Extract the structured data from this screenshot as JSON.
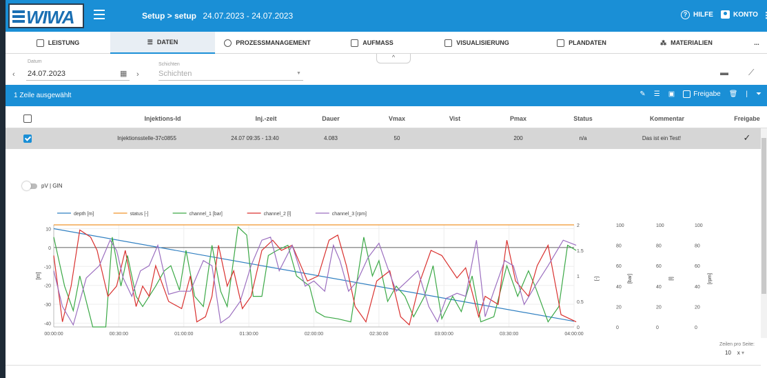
{
  "header": {
    "crumb": "Setup > setup",
    "dates": "24.07.2023 - 24.07.2023",
    "help": "HILFE",
    "account": "KONTO"
  },
  "tabs": [
    {
      "label": "LEISTUNG",
      "icon": "chart-area-icon"
    },
    {
      "label": "DATEN",
      "icon": "list-icon",
      "active": true
    },
    {
      "label": "PROZESSMANAGEMENT",
      "icon": "clock-icon"
    },
    {
      "label": "AUFMASS",
      "icon": "clipboard-icon"
    },
    {
      "label": "VISUALISIERUNG",
      "icon": "map-icon"
    },
    {
      "label": "PLANDATEN",
      "icon": "plus-box-icon"
    },
    {
      "label": "MATERIALIEN",
      "icon": "molecule-icon"
    },
    {
      "label": "..."
    }
  ],
  "filters": {
    "date_label": "Datum",
    "date_value": "24.07.2023",
    "shift_label": "Schichten",
    "shift_placeholder": "Schichten"
  },
  "toolbar": {
    "selection": "1 Zeile ausgewählt",
    "release": "Freigabe"
  },
  "table": {
    "columns": [
      "Injektions-Id",
      "Inj.-zeit",
      "Dauer",
      "Vmax",
      "Vist",
      "Pmax",
      "Status",
      "Kommentar",
      "Freigabe"
    ],
    "rows": [
      {
        "id": "Injektionsstelle-37c0855",
        "time": "24.07 09:35 - 13:40",
        "duration": "4.083",
        "vmax": "50",
        "vist": "",
        "pmax": "200",
        "status": "n/a",
        "comment": "Das ist ein Test!",
        "released": "✓"
      }
    ]
  },
  "detail": {
    "toggle_label": "pV | GIN"
  },
  "pager": {
    "label": "Zeilen pro Seite:",
    "value": "10",
    "clear": "x"
  },
  "colors": {
    "brand": "#1a8fd6",
    "selected_row": "#d6d6d6"
  },
  "chart_data": {
    "type": "line",
    "x_ticks": [
      "00:00:00",
      "00:30:00",
      "01:00:00",
      "01:30:00",
      "02:00:00",
      "02:30:00",
      "03:00:00",
      "03:30:00",
      "04:00:00"
    ],
    "axes": [
      {
        "label": "[m]",
        "ticks": [
          "10",
          "0",
          "-10",
          "-20",
          "-30",
          "-40"
        ],
        "range": [
          -42,
          12
        ]
      },
      {
        "label": "[-]",
        "ticks": [
          "2",
          "1.5",
          "1",
          "0.5",
          "0"
        ],
        "range": [
          0,
          2
        ]
      },
      {
        "label": "[bar]",
        "ticks": [
          "100",
          "80",
          "60",
          "40",
          "20",
          "0"
        ],
        "range": [
          0,
          100
        ]
      },
      {
        "label": "[l]",
        "ticks": [
          "100",
          "80",
          "60",
          "40",
          "20",
          "0"
        ],
        "range": [
          0,
          100
        ]
      },
      {
        "label": "[rpm]",
        "ticks": [
          "100",
          "80",
          "60",
          "40",
          "20",
          "0"
        ],
        "range": [
          0,
          100
        ]
      }
    ],
    "series": [
      {
        "name": "depth [m]",
        "color": "#2f7fc1",
        "axis": 0,
        "points": [
          [
            0,
            10
          ],
          [
            240,
            -39
          ]
        ]
      },
      {
        "name": "status [-]",
        "color": "#f0942a",
        "axis": 1,
        "points": [
          [
            0,
            2
          ],
          [
            240,
            2
          ]
        ]
      },
      {
        "name": "channel_1 [bar]",
        "color": "#3aa845",
        "axis": 2,
        "points": [
          [
            0,
            88
          ],
          [
            5,
            40
          ],
          [
            9,
            16
          ],
          [
            12,
            50
          ],
          [
            18,
            0
          ],
          [
            24,
            0
          ],
          [
            27,
            88
          ],
          [
            31,
            40
          ],
          [
            34,
            70
          ],
          [
            38,
            30
          ],
          [
            41,
            20
          ],
          [
            47,
            40
          ],
          [
            51,
            55
          ],
          [
            54,
            60
          ],
          [
            58,
            36
          ],
          [
            61,
            75
          ],
          [
            65,
            30
          ],
          [
            69,
            20
          ],
          [
            73,
            80
          ],
          [
            77,
            35
          ],
          [
            80,
            20
          ],
          [
            85,
            98
          ],
          [
            89,
            90
          ],
          [
            92,
            30
          ],
          [
            96,
            30
          ],
          [
            99,
            70
          ],
          [
            103,
            75
          ],
          [
            108,
            80
          ],
          [
            112,
            50
          ],
          [
            118,
            40
          ],
          [
            121,
            15
          ],
          [
            125,
            10
          ],
          [
            131,
            8
          ],
          [
            137,
            5
          ],
          [
            143,
            88
          ],
          [
            147,
            50
          ],
          [
            150,
            65
          ],
          [
            154,
            25
          ],
          [
            158,
            40
          ],
          [
            162,
            30
          ],
          [
            166,
            10
          ],
          [
            171,
            30
          ],
          [
            175,
            60
          ],
          [
            179,
            8
          ],
          [
            184,
            30
          ],
          [
            188,
            15
          ],
          [
            193,
            50
          ],
          [
            197,
            5
          ],
          [
            203,
            10
          ],
          [
            209,
            60
          ],
          [
            214,
            30
          ],
          [
            219,
            55
          ],
          [
            222,
            40
          ],
          [
            228,
            5
          ],
          [
            233,
            20
          ],
          [
            237,
            80
          ],
          [
            241,
            75
          ]
        ]
      },
      {
        "name": "channel_2 [l]",
        "color": "#d9302e",
        "axis": 3,
        "points": [
          [
            0,
            70
          ],
          [
            4,
            5
          ],
          [
            8,
            40
          ],
          [
            12,
            95
          ],
          [
            17,
            88
          ],
          [
            20,
            75
          ],
          [
            25,
            30
          ],
          [
            29,
            40
          ],
          [
            33,
            75
          ],
          [
            38,
            20
          ],
          [
            41,
            40
          ],
          [
            44,
            30
          ],
          [
            47,
            60
          ],
          [
            53,
            25
          ],
          [
            59,
            18
          ],
          [
            63,
            50
          ],
          [
            66,
            5
          ],
          [
            70,
            10
          ],
          [
            73,
            30
          ],
          [
            76,
            80
          ],
          [
            80,
            40
          ],
          [
            83,
            55
          ],
          [
            87,
            18
          ],
          [
            91,
            30
          ],
          [
            96,
            75
          ],
          [
            101,
            85
          ],
          [
            105,
            75
          ],
          [
            110,
            80
          ],
          [
            114,
            60
          ],
          [
            117,
            45
          ],
          [
            122,
            50
          ],
          [
            127,
            85
          ],
          [
            131,
            90
          ],
          [
            135,
            60
          ],
          [
            139,
            20
          ],
          [
            144,
            5
          ],
          [
            149,
            45
          ],
          [
            155,
            55
          ],
          [
            160,
            10
          ],
          [
            164,
            2
          ],
          [
            169,
            45
          ],
          [
            174,
            75
          ],
          [
            179,
            70
          ],
          [
            186,
            48
          ],
          [
            190,
            58
          ],
          [
            196,
            10
          ],
          [
            199,
            30
          ],
          [
            205,
            22
          ],
          [
            209,
            85
          ],
          [
            213,
            45
          ],
          [
            219,
            30
          ],
          [
            223,
            60
          ],
          [
            228,
            80
          ],
          [
            234,
            12
          ],
          [
            241,
            5
          ]
        ]
      },
      {
        "name": "channel_3 [rpm]",
        "color": "#9b6ebf",
        "axis": 4,
        "points": [
          [
            0,
            55
          ],
          [
            4,
            20
          ],
          [
            9,
            2
          ],
          [
            15,
            48
          ],
          [
            21,
            60
          ],
          [
            26,
            85
          ],
          [
            29,
            75
          ],
          [
            32,
            48
          ],
          [
            36,
            30
          ],
          [
            40,
            55
          ],
          [
            44,
            60
          ],
          [
            48,
            80
          ],
          [
            53,
            32
          ],
          [
            58,
            35
          ],
          [
            63,
            35
          ],
          [
            69,
            65
          ],
          [
            73,
            60
          ],
          [
            77,
            4
          ],
          [
            81,
            10
          ],
          [
            86,
            25
          ],
          [
            91,
            60
          ],
          [
            96,
            85
          ],
          [
            100,
            88
          ],
          [
            104,
            55
          ],
          [
            110,
            80
          ],
          [
            116,
            40
          ],
          [
            120,
            45
          ],
          [
            125,
            35
          ],
          [
            129,
            80
          ],
          [
            132,
            65
          ],
          [
            136,
            35
          ],
          [
            140,
            45
          ],
          [
            145,
            68
          ],
          [
            150,
            82
          ],
          [
            154,
            58
          ],
          [
            158,
            35
          ],
          [
            163,
            45
          ],
          [
            168,
            55
          ],
          [
            173,
            20
          ],
          [
            177,
            5
          ],
          [
            181,
            28
          ],
          [
            186,
            33
          ],
          [
            190,
            30
          ],
          [
            195,
            85
          ],
          [
            199,
            10
          ],
          [
            203,
            35
          ],
          [
            208,
            65
          ],
          [
            212,
            60
          ],
          [
            217,
            22
          ],
          [
            222,
            40
          ],
          [
            228,
            60
          ],
          [
            235,
            85
          ],
          [
            241,
            80
          ]
        ]
      }
    ]
  }
}
